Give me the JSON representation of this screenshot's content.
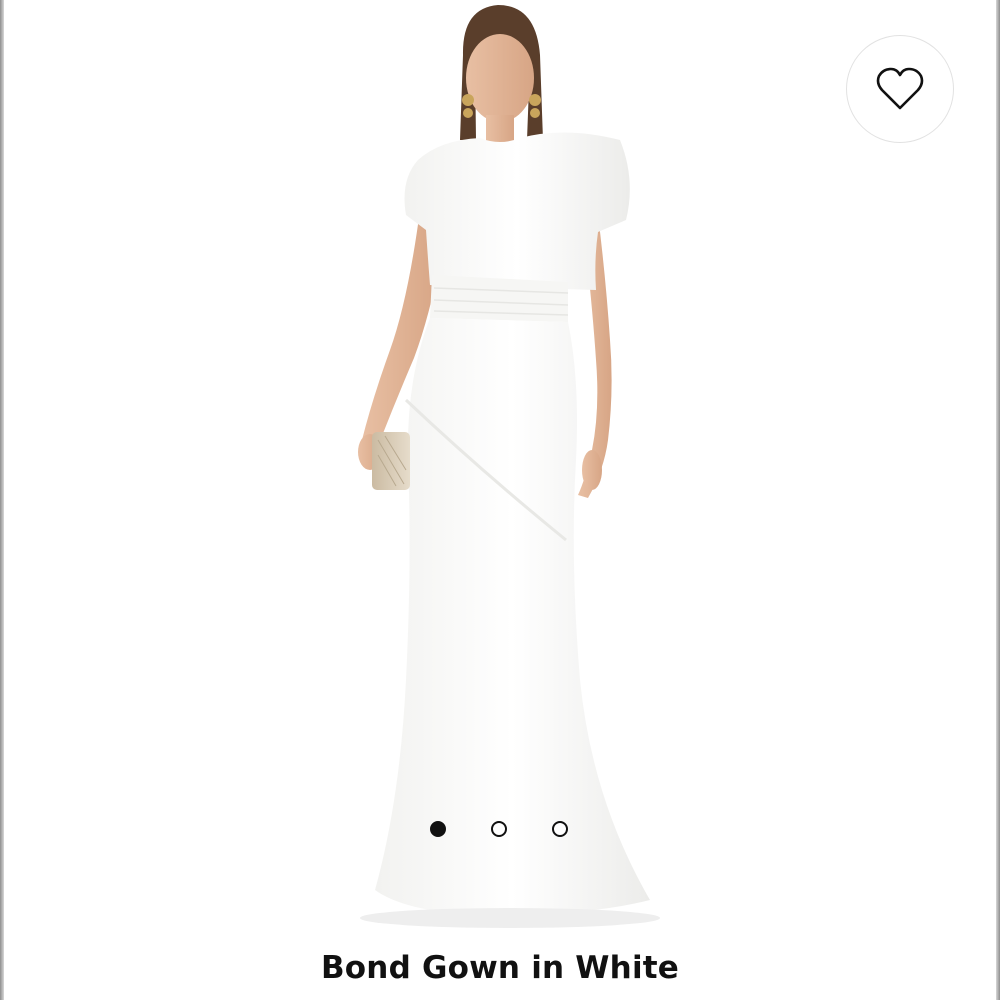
{
  "product": {
    "title": "Bond Gown in White",
    "image_alt": "Model wearing white satin gown holding a woven clutch"
  },
  "favorite": {
    "icon": "heart-outline-icon",
    "selected": false
  },
  "carousel": {
    "count": 3,
    "active_index": 0
  },
  "colors": {
    "background": "#ffffff",
    "dot_active": "#111111",
    "title": "#111111"
  }
}
